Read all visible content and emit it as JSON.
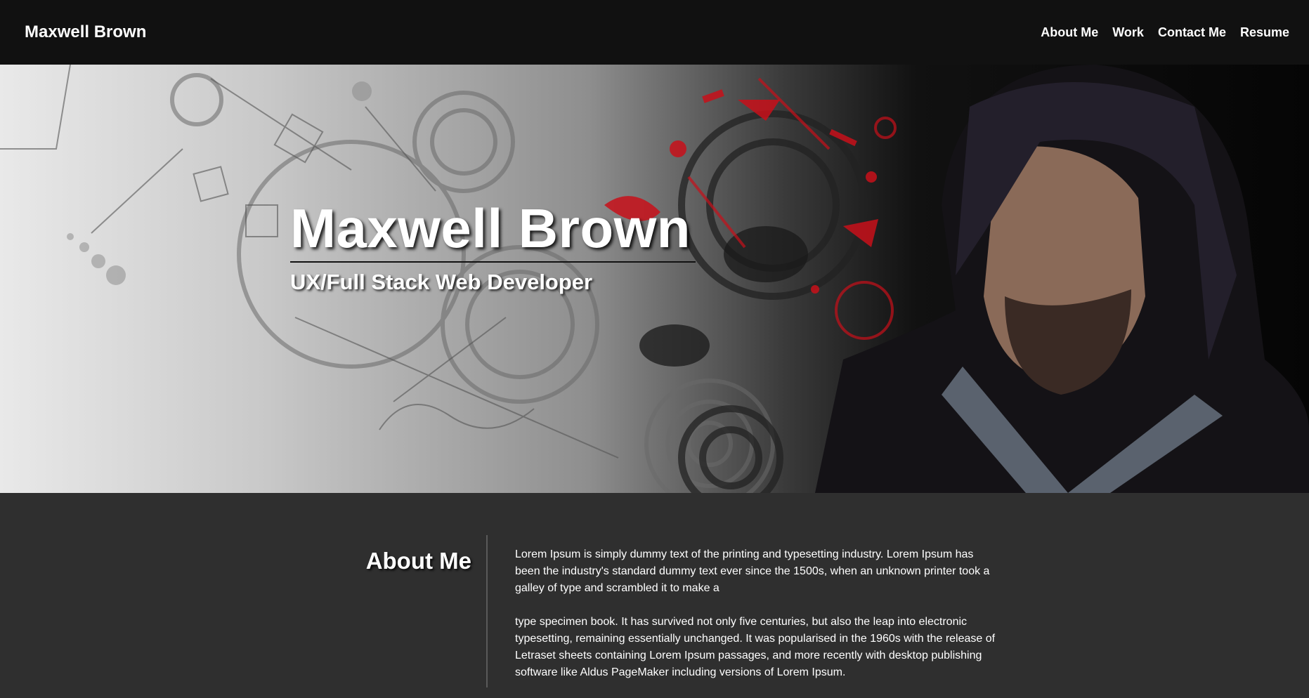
{
  "navbar": {
    "brand": "Maxwell Brown",
    "links": [
      "About Me",
      "Work",
      "Contact Me",
      "Resume"
    ]
  },
  "hero": {
    "title": "Maxwell Brown",
    "subtitle": "UX/Full Stack Web Developer"
  },
  "about": {
    "heading": "About Me",
    "paragraphs": [
      "Lorem Ipsum is simply dummy text of the printing and typesetting industry. Lorem Ipsum has been the industry's standard dummy text ever since the 1500s, when an unknown printer took a galley of type and scrambled it to make a",
      "type specimen book. It has survived not only five centuries, but also the leap into electronic typesetting, remaining essentially unchanged. It was popularised in the 1960s with the release of Letraset sheets containing Lorem Ipsum passages, and more recently with desktop publishing software like Aldus PageMaker including versions of Lorem Ipsum."
    ]
  },
  "colors": {
    "navbar_bg": "#111111",
    "page_bg": "#2f2f2f",
    "accent_red": "#c8101a"
  }
}
